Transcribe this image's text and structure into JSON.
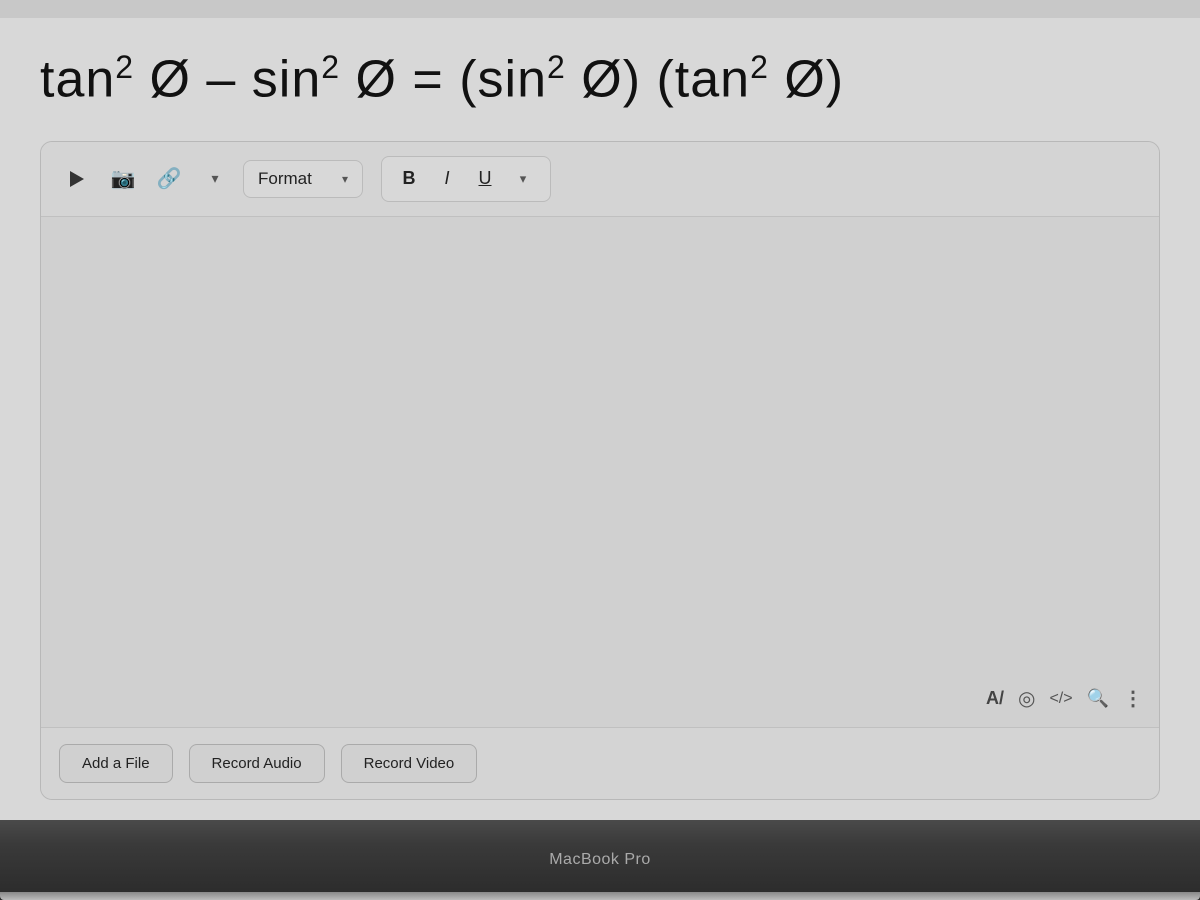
{
  "screen": {
    "background_color": "#d0d0d0"
  },
  "math": {
    "formula": "tan² Ø – sin² Ø = (sin² Ø) (tan² Ø)"
  },
  "toolbar": {
    "format_label": "Format",
    "chevron": "▾",
    "bold_label": "B",
    "italic_label": "I",
    "underline_label": "U",
    "chevron_right": "▾"
  },
  "bottom_icons": {
    "font_icon": "A/",
    "eye_icon": "◉",
    "code_icon": "</>",
    "search_icon": "🔍",
    "more_icon": "⋯"
  },
  "action_buttons": {
    "add_file": "Add a File",
    "record_audio": "Record Audio",
    "record_video": "Record Video"
  },
  "macbook_label": "MacBook Pro"
}
